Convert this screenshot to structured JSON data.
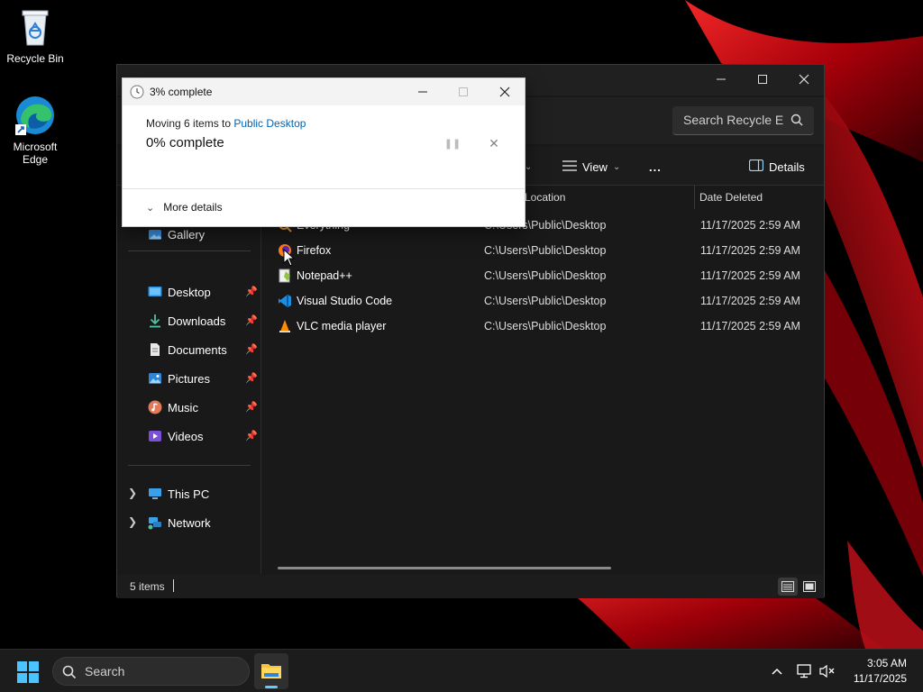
{
  "desktop": {
    "icons": [
      {
        "label": "Recycle Bin",
        "icon": "recycle-bin-icon"
      },
      {
        "label": "Microsoft Edge",
        "icon": "edge-icon"
      }
    ]
  },
  "explorer": {
    "search_placeholder": "Search Recycle E",
    "toolbar": {
      "view_label": "View",
      "more_label": "...",
      "details_label": "Details"
    },
    "columns": {
      "location": "Location",
      "date_deleted": "Date Deleted"
    },
    "nav": {
      "gallery": "Gallery",
      "quick_access": [
        {
          "label": "Desktop",
          "icon": "desktop-folder-icon",
          "pinned": true
        },
        {
          "label": "Downloads",
          "icon": "downloads-icon",
          "pinned": true
        },
        {
          "label": "Documents",
          "icon": "documents-icon",
          "pinned": true
        },
        {
          "label": "Pictures",
          "icon": "pictures-icon",
          "pinned": true
        },
        {
          "label": "Music",
          "icon": "music-icon",
          "pinned": true
        },
        {
          "label": "Videos",
          "icon": "videos-icon",
          "pinned": true
        }
      ],
      "this_pc": "This PC",
      "network": "Network"
    },
    "items": [
      {
        "name": "Everything",
        "location": "C:\\Users\\Public\\Desktop",
        "date": "11/17/2025 2:59 AM",
        "icon": "everything-icon"
      },
      {
        "name": "Firefox",
        "location": "C:\\Users\\Public\\Desktop",
        "date": "11/17/2025 2:59 AM",
        "icon": "firefox-icon"
      },
      {
        "name": "Notepad++",
        "location": "C:\\Users\\Public\\Desktop",
        "date": "11/17/2025 2:59 AM",
        "icon": "notepadpp-icon"
      },
      {
        "name": "Visual Studio Code",
        "location": "C:\\Users\\Public\\Desktop",
        "date": "11/17/2025 2:59 AM",
        "icon": "vscode-icon"
      },
      {
        "name": "VLC media player",
        "location": "C:\\Users\\Public\\Desktop",
        "date": "11/17/2025 2:59 AM",
        "icon": "vlc-icon"
      }
    ],
    "status": {
      "count": "5 items"
    }
  },
  "dialog": {
    "title": "3% complete",
    "message_prefix": "Moving 6 items to ",
    "destination": "Public Desktop",
    "percent": "0% complete",
    "more_details": "More details"
  },
  "taskbar": {
    "search_label": "Search",
    "time": "3:05 AM",
    "date": "11/17/2025"
  },
  "colors": {
    "accent": "#0063b1",
    "taskbar_indicator": "#60cdff",
    "wallpaper_red": "#c8101a"
  }
}
